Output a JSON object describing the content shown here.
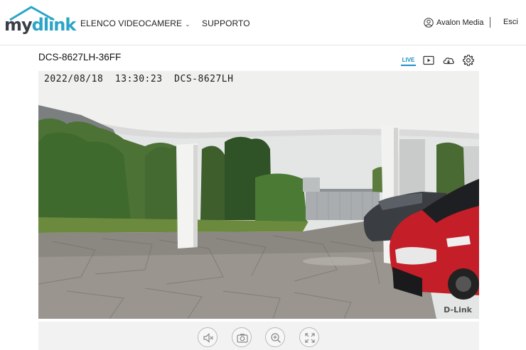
{
  "brand": {
    "my": "my",
    "dlink": "dlink",
    "accent": "#2aa5c7"
  },
  "nav": {
    "cameras": "ELENCO VIDEOCAMERE",
    "cameras_chevron": "chevron-down-icon",
    "support": "SUPPORTO"
  },
  "user": {
    "icon": "user-icon",
    "name": "Avalon Media",
    "logout": "Esci"
  },
  "device": {
    "title": "DCS-8627LH-36FF"
  },
  "toolbar": {
    "live_label": "LIVE",
    "live_color": "#1a8fc6",
    "icons": [
      "play-recordings-icon",
      "cloud-download-icon",
      "gear-icon"
    ]
  },
  "video": {
    "timestamp": "2022/08/18  13:30:23  DCS-8627LH",
    "watermark": "D-Link"
  },
  "controls": {
    "icons": [
      "speaker-mute-icon",
      "camera-snapshot-icon",
      "zoom-in-icon",
      "fullscreen-icon"
    ]
  }
}
